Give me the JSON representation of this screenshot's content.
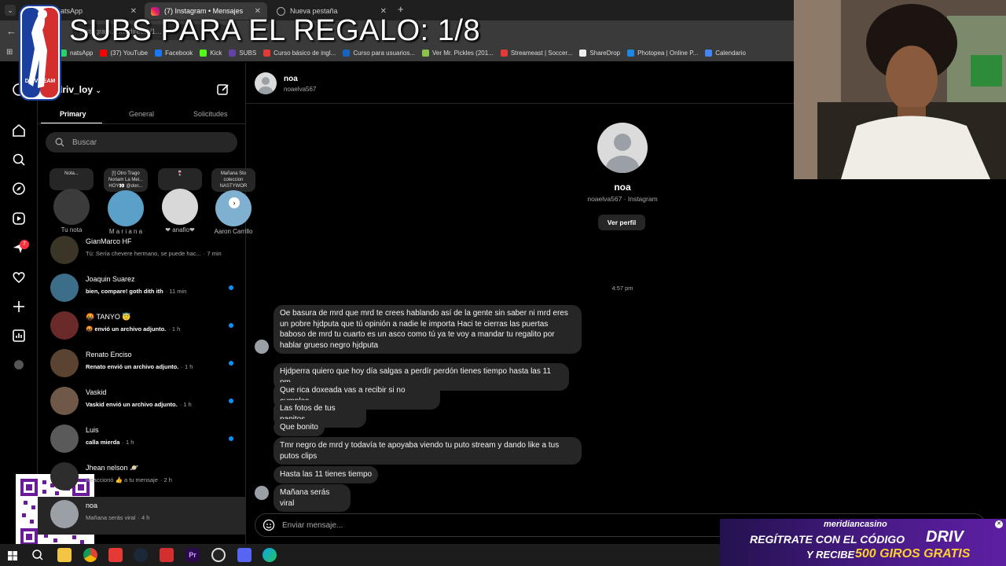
{
  "stream_overlay": {
    "title": "SUBS PARA EL REGALO: 1/8",
    "logo_text": "DRIV TEAM"
  },
  "browser": {
    "tabs": [
      {
        "label": "natsApp"
      },
      {
        "label": "(7) Instagram • Mensajes"
      },
      {
        "label": "Nueva pestaña"
      }
    ],
    "new_tab": "+",
    "address": "instagram.com/direct/t/1...",
    "bookmarks": [
      {
        "label": "natsApp",
        "color": "#25d366"
      },
      {
        "label": "(37) YouTube",
        "color": "#ff0000"
      },
      {
        "label": "Facebook",
        "color": "#1877f2"
      },
      {
        "label": "Kick",
        "color": "#53fc18"
      },
      {
        "label": "SUBS",
        "color": "#6441a5"
      },
      {
        "label": "Curso básico de ingl...",
        "color": "#e53935"
      },
      {
        "label": "Curso para usuarios...",
        "color": "#1565c0"
      },
      {
        "label": "Ver Mr. Pickles (201...",
        "color": "#8bc34a"
      },
      {
        "label": "Streameast | Soccer...",
        "color": "#e53935"
      },
      {
        "label": "ShareDrop",
        "color": "#eeeeee"
      },
      {
        "label": "Photopea | Online P...",
        "color": "#1e88e5"
      },
      {
        "label": "Calendario",
        "color": "#4285f4"
      }
    ]
  },
  "instagram": {
    "account": "driv_loy",
    "notifications_badge": "7",
    "inbox_tabs": [
      "Primary",
      "General",
      "Solicitudes"
    ],
    "search_placeholder": "Buscar",
    "stories": [
      {
        "bubble": "Nota...",
        "name": "Tu nota",
        "color": "#3b3b3b"
      },
      {
        "bubble": "[!] Otro Trago\nNoriam La Mel...\nHOY👀 @don...",
        "name": "M a r i a n a",
        "color": "#5aa0c8"
      },
      {
        "bubble": "🍷",
        "name": "❤ anafio❤",
        "color": "#d8d8d8"
      },
      {
        "bubble": "Mañana Sto\ncoleccion\nNASTYWOR",
        "name": "Aaron Carrillo",
        "color": "#7fb0d0"
      }
    ],
    "threads": [
      {
        "name": "GianMarco HF",
        "preview": "Tú: Sería chevere hermano, se puede hac...",
        "time": "· 7 min",
        "unread": false,
        "color": "#3a3526"
      },
      {
        "name": "Joaquin Suarez",
        "preview": "bien, compare! goth dith ith",
        "time": "· 11 min",
        "unread": true,
        "color": "#3c6e8a"
      },
      {
        "name": "🤬 TANYO 😇",
        "preview": "🤬 envió un archivo adjunto.",
        "time": "· 1 h",
        "unread": true,
        "color": "#6b2a2a"
      },
      {
        "name": "Renato Enciso",
        "preview": "Renato envió un archivo adjunto.",
        "time": "· 1 h",
        "unread": true,
        "color": "#5a4330"
      },
      {
        "name": "Vaskid",
        "preview": "Vaskid envió un archivo adjunto.",
        "time": "· 1 h",
        "unread": true,
        "color": "#705848"
      },
      {
        "name": "Luis",
        "preview": "calla mierda",
        "time": "· 1 h",
        "unread": true,
        "color": "#5a5a5a"
      },
      {
        "name": "Jhean nelson 🪐",
        "preview": "Reaccionó 👍 a tu mensaje",
        "time": "· 2 h",
        "unread": false,
        "color": "#2d2d2d"
      },
      {
        "name": "noa",
        "preview": "Mañana serás viral",
        "time": "· 4 h",
        "unread": false,
        "color": "#9aa0a6"
      }
    ],
    "chat": {
      "name": "noa",
      "handle": "noaelva567",
      "profile_name": "noa",
      "profile_sub": "noaelva567 · Instagram",
      "view_profile": "Ver perfil",
      "timestamp": "4:57 pm",
      "messages": [
        "Oe basura de mrd que mrd te crees hablando así de la gente sin saber ni mrd eres un pobre hjdputa que tú opinión a nadie le importa Haci te cierras las puertas baboso de mrd tu cuarto es un asco como tú ya te voy a mandar tu regalito por hablar grueso negro hjdputa",
        "Hjdperra quiero que hoy día salgas a perdír perdón tienes tiempo hasta las 11 pm",
        "Que rica doxeada vas a recibir si no cumples",
        "Las fotos de tus papitos",
        "Que bonito",
        "Tmr negro de mrd y todavía te apoyaba viendo tu puto stream y dando like a tus putos clips",
        "Hasta las 11 tienes tiempo",
        "Mañana serás viral"
      ],
      "composer_placeholder": "Enviar mensaje..."
    }
  },
  "ad": {
    "brand": "meridiancasino",
    "line1": "REGÍTRATE CON EL CÓDIGO",
    "code": "DRIV",
    "line2_prefix": "Y RECIBE",
    "line2_highlight": "500 GIROS GRATIS"
  },
  "qr": {
    "label": "yape"
  }
}
